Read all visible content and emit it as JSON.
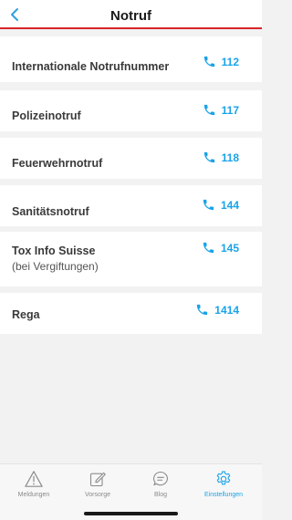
{
  "header": {
    "title": "Notruf"
  },
  "entries": [
    {
      "label": "Internationale Notrufnummer",
      "sub": "",
      "number": "112"
    },
    {
      "label": "Polizeinotruf",
      "sub": "",
      "number": "117"
    },
    {
      "label": "Feuerwehrnotruf",
      "sub": "",
      "number": "118"
    },
    {
      "label": "Sanitätsnotruf",
      "sub": "",
      "number": "144"
    },
    {
      "label": "Tox Info Suisse",
      "sub": "(bei Vergiftungen)",
      "number": "145"
    },
    {
      "label": "Rega",
      "sub": "",
      "number": "1414"
    }
  ],
  "tabs": [
    {
      "label": "Meldungen",
      "icon": "warning-icon",
      "active": false
    },
    {
      "label": "Vorsorge",
      "icon": "edit-icon",
      "active": false
    },
    {
      "label": "Blog",
      "icon": "chat-icon",
      "active": false
    },
    {
      "label": "Einstellungen",
      "icon": "gear-icon",
      "active": true
    }
  ],
  "colors": {
    "accent": "#1aa3e8",
    "header_line": "#d6242b"
  }
}
